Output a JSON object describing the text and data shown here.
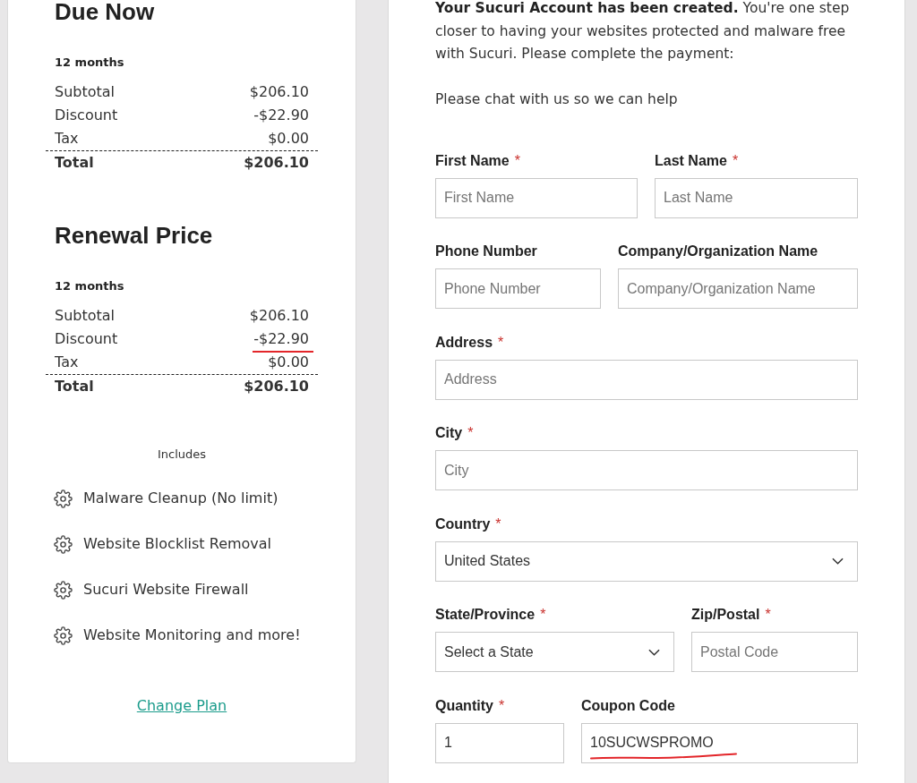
{
  "order_summary": {
    "sections": [
      {
        "title": "Due Now",
        "term": "12 months",
        "rows": [
          {
            "kind": "line",
            "label": "Subtotal",
            "value": "$206.10",
            "underlined": false
          },
          {
            "kind": "line",
            "label": "Discount",
            "value": "-$22.90",
            "underlined": false
          },
          {
            "kind": "line",
            "label": "Tax",
            "value": "$0.00",
            "underlined": false
          },
          {
            "kind": "total",
            "label": "Total",
            "value": "$206.10",
            "underlined": false
          }
        ]
      },
      {
        "title": "Renewal Price",
        "term": "12 months",
        "rows": [
          {
            "kind": "line",
            "label": "Subtotal",
            "value": "$206.10",
            "underlined": false
          },
          {
            "kind": "line",
            "label": "Discount",
            "value": "-$22.90",
            "underlined": true
          },
          {
            "kind": "line",
            "label": "Tax",
            "value": "$0.00",
            "underlined": false
          },
          {
            "kind": "total",
            "label": "Total",
            "value": "$206.10",
            "underlined": false
          }
        ]
      }
    ],
    "includes": {
      "heading": "Includes",
      "items": [
        "Malware Cleanup (No limit)",
        "Website Blocklist Removal",
        "Sucuri Website Firewall",
        "Website Monitoring and more!"
      ]
    },
    "change_plan_link": "Change Plan"
  },
  "checkout": {
    "intro": "**Your Sucuri Account has been created.** You're one step closer to having your websites protected and malware free with Sucuri. Please complete the payment:",
    "help_text": "Please chat with us so we can help",
    "form_rows": [
      [
        {
          "kind": "text",
          "label": "First Name",
          "required_mark": "*",
          "placeholder": "First Name",
          "underlined": false
        },
        {
          "kind": "text",
          "label": "Last Name",
          "required_mark": "*",
          "placeholder": "Last Name",
          "underlined": false
        }
      ],
      [
        {
          "kind": "text",
          "label": "Phone Number",
          "placeholder": "Phone Number",
          "underlined": false
        },
        {
          "kind": "text",
          "label": "Company/Organization Name",
          "placeholder": "Company/Organization Name",
          "underlined": false
        }
      ],
      [
        {
          "kind": "text",
          "label": "Address",
          "required_mark": "*",
          "placeholder": "Address",
          "underlined": false
        }
      ],
      [
        {
          "kind": "text",
          "label": "City",
          "required_mark": "*",
          "placeholder": "City",
          "underlined": false
        }
      ],
      [
        {
          "kind": "select",
          "label": "Country",
          "required_mark": "*",
          "value": "United States",
          "underlined": false
        }
      ],
      [
        {
          "kind": "select",
          "label": "State/Province",
          "required_mark": "*",
          "value": "Select a State",
          "underlined": false
        },
        {
          "kind": "text",
          "label": "Zip/Postal",
          "required_mark": "*",
          "placeholder": "Postal Code",
          "underlined": false
        }
      ],
      [
        {
          "kind": "text",
          "label": "Quantity",
          "required_mark": "*",
          "value": "1",
          "underlined": false
        },
        {
          "kind": "text",
          "label": "Coupon Code",
          "value": "10SUCWSPROMO",
          "underlined": true
        }
      ]
    ]
  }
}
